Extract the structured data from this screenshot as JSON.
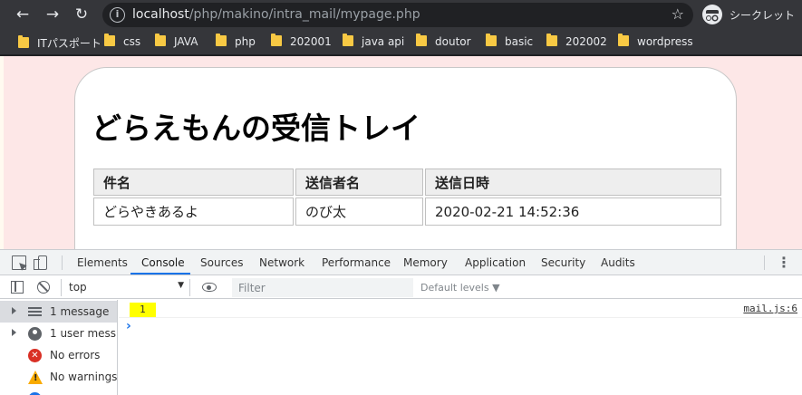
{
  "browser": {
    "url_host": "localhost",
    "url_path": "/php/makino/intra_mail/mypage.php",
    "incognito_label": "シークレット",
    "bookmarks": [
      "ITパスポート",
      "css",
      "JAVA",
      "php",
      "202001",
      "java api",
      "doutor",
      "basic",
      "202002",
      "wordpress"
    ]
  },
  "page": {
    "title": "どらえもんの受信トレイ",
    "columns": [
      "件名",
      "送信者名",
      "送信日時"
    ],
    "rows": [
      [
        "どらやきあるよ",
        "のび太",
        "2020-02-21 14:52:36"
      ]
    ]
  },
  "devtools": {
    "tabs": [
      "Elements",
      "Console",
      "Sources",
      "Network",
      "Performance",
      "Memory",
      "Application",
      "Security",
      "Audits"
    ],
    "active_tab": "Console",
    "context": "top",
    "filter_placeholder": "Filter",
    "levels_label": "Default levels ▼",
    "sidebar": [
      {
        "label": "1 message",
        "icon": "list-icon",
        "selected": true
      },
      {
        "label": "1 user mess...",
        "icon": "user-icon",
        "selected": false
      },
      {
        "label": "No errors",
        "icon": "error-icon",
        "selected": false
      },
      {
        "label": "No warnings",
        "icon": "warning-icon",
        "selected": false
      }
    ],
    "messages": [
      {
        "value": "1",
        "source": "mail.js:6"
      }
    ],
    "prompt_symbol": "›"
  },
  "colors": {
    "page_background": "#fde7e7",
    "highlight": "#ffff00",
    "accent": "#1a73e8"
  }
}
